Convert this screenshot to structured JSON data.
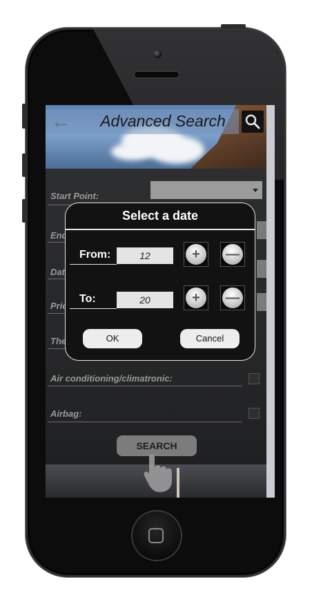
{
  "header": {
    "title": "Advanced Search",
    "back_icon": "arrow-left-icon",
    "search_icon": "search-icon"
  },
  "form": {
    "rows": [
      {
        "label": "Start Point:"
      },
      {
        "label": "End Point:"
      },
      {
        "label": "Date:"
      },
      {
        "label": "Price:"
      },
      {
        "label": "The"
      },
      {
        "label": "Air conditioning/climatronic:"
      },
      {
        "label": "Airbag:"
      }
    ],
    "visible_fragments": {
      "end_point": "End",
      "date": "Dat",
      "price": "Pric",
      "theme": "The"
    },
    "search_button": "SEARCH"
  },
  "dialog": {
    "title": "Select a date",
    "from_label": "From:",
    "from_value": "12",
    "to_label": "To:",
    "to_value": "20",
    "plus_icon": "plus-icon",
    "minus_icon": "minus-icon",
    "ok_label": "OK",
    "cancel_label": "Cancel"
  },
  "colors": {
    "dialog_bg": "#121212",
    "dialog_border": "#e6e6e6",
    "screen_bg": "#2a2b2d",
    "button_grey": "#7c7c7c"
  }
}
